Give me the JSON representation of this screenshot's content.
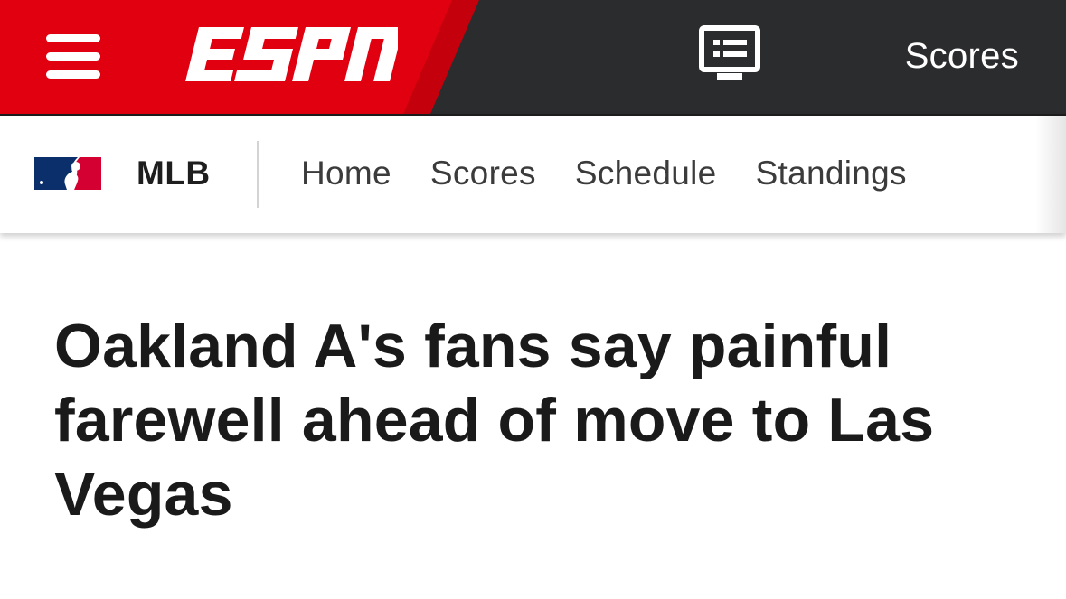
{
  "header": {
    "brand": "ESPN",
    "scores_label": "Scores",
    "colors": {
      "brand_red": "#e0000f",
      "bar_dark": "#2b2c2d"
    },
    "icons": {
      "menu": "hamburger-menu-icon",
      "watch": "watch-screen-icon"
    }
  },
  "subnav": {
    "league_logo": "mlb-logo",
    "league": "MLB",
    "links": [
      "Home",
      "Scores",
      "Schedule",
      "Standings"
    ]
  },
  "article": {
    "headline": "Oakland A's fans say painful farewell ahead of move to Las Vegas"
  }
}
